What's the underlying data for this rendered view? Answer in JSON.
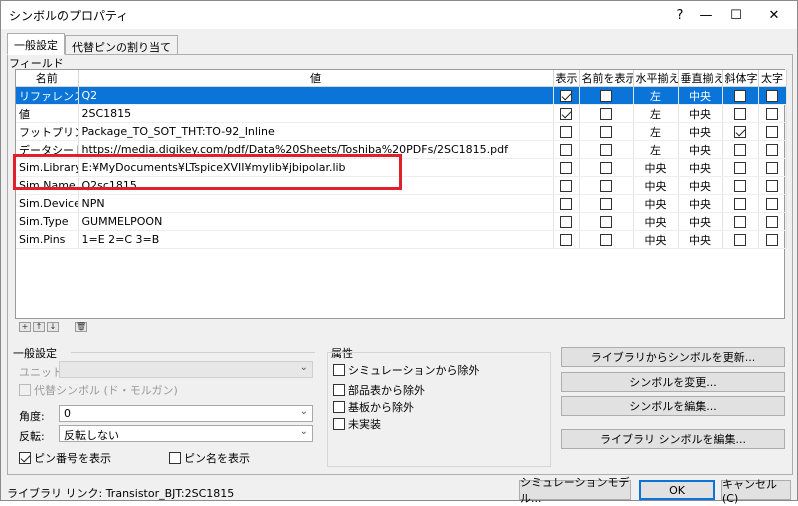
{
  "window": {
    "title": "シンボルのプロパティ",
    "help": "?",
    "minimize": "—",
    "maximize": "☐",
    "close": "✕"
  },
  "tabs": [
    {
      "label": "一般設定"
    },
    {
      "label": "代替ピンの割り当て"
    }
  ],
  "fields": {
    "group_label": "フィールド",
    "headers": [
      "名前",
      "値",
      "表示",
      "名前を表示",
      "水平揃え",
      "垂直揃え",
      "斜体字",
      "太字"
    ],
    "rows": [
      {
        "name": "リファレンス",
        "value": "Q2",
        "show": true,
        "show_name": false,
        "h_align": "左",
        "v_align": "中央",
        "italic": false,
        "bold": false
      },
      {
        "name": "値",
        "value": "2SC1815",
        "show": true,
        "show_name": false,
        "h_align": "左",
        "v_align": "中央",
        "italic": false,
        "bold": false
      },
      {
        "name": "フットプリント",
        "value": "Package_TO_SOT_THT:TO-92_Inline",
        "show": false,
        "show_name": false,
        "h_align": "左",
        "v_align": "中央",
        "italic": true,
        "bold": false
      },
      {
        "name": "データシート",
        "value": "https://media.digikey.com/pdf/Data%20Sheets/Toshiba%20PDFs/2SC1815.pdf",
        "show": false,
        "show_name": false,
        "h_align": "左",
        "v_align": "中央",
        "italic": false,
        "bold": false
      },
      {
        "name": "Sim.Library",
        "value": "E:¥MyDocuments¥LTspiceXVII¥mylib¥jbipolar.lib",
        "show": false,
        "show_name": false,
        "h_align": "中央",
        "v_align": "中央",
        "italic": false,
        "bold": false
      },
      {
        "name": "Sim.Name",
        "value": "Q2sc1815",
        "show": false,
        "show_name": false,
        "h_align": "中央",
        "v_align": "中央",
        "italic": false,
        "bold": false
      },
      {
        "name": "Sim.Device",
        "value": "NPN",
        "show": false,
        "show_name": false,
        "h_align": "中央",
        "v_align": "中央",
        "italic": false,
        "bold": false
      },
      {
        "name": "Sim.Type",
        "value": "GUMMELPOON",
        "show": false,
        "show_name": false,
        "h_align": "中央",
        "v_align": "中央",
        "italic": false,
        "bold": false
      },
      {
        "name": "Sim.Pins",
        "value": "1=E 2=C 3=B",
        "show": false,
        "show_name": false,
        "h_align": "中央",
        "v_align": "中央",
        "italic": false,
        "bold": false
      }
    ],
    "tools": {
      "add": "+",
      "up": "↑",
      "down": "↓",
      "delete": "🗑"
    }
  },
  "general": {
    "label": "一般設定",
    "unit_label": "ユニット:",
    "unit_value": "",
    "alt_symbol_label": "代替シンボル (ド・モルガン)",
    "angle_label": "角度:",
    "angle_value": "0",
    "mirror_label": "反転:",
    "mirror_value": "反転しない",
    "show_pin_number": "ピン番号を表示",
    "show_pin_name": "ピン名を表示",
    "dropdown_arrow": "⌄"
  },
  "attributes": {
    "label": "属性",
    "exclude_sim": "シミュレーションから除外",
    "exclude_bom": "部品表から除外",
    "exclude_board": "基板から除外",
    "dnp": "未実装"
  },
  "buttons": {
    "update_from_lib": "ライブラリからシンボルを更新...",
    "change_symbol": "シンボルを変更...",
    "edit_symbol": "シンボルを編集...",
    "edit_lib_symbol": "ライブラリ シンボルを編集...",
    "sim_model": "シミュレーションモデル...",
    "ok": "OK",
    "cancel": "キャンセル (C)"
  },
  "status": {
    "library_link": "ライブラリ リンク: Transistor_BJT:2SC1815"
  }
}
